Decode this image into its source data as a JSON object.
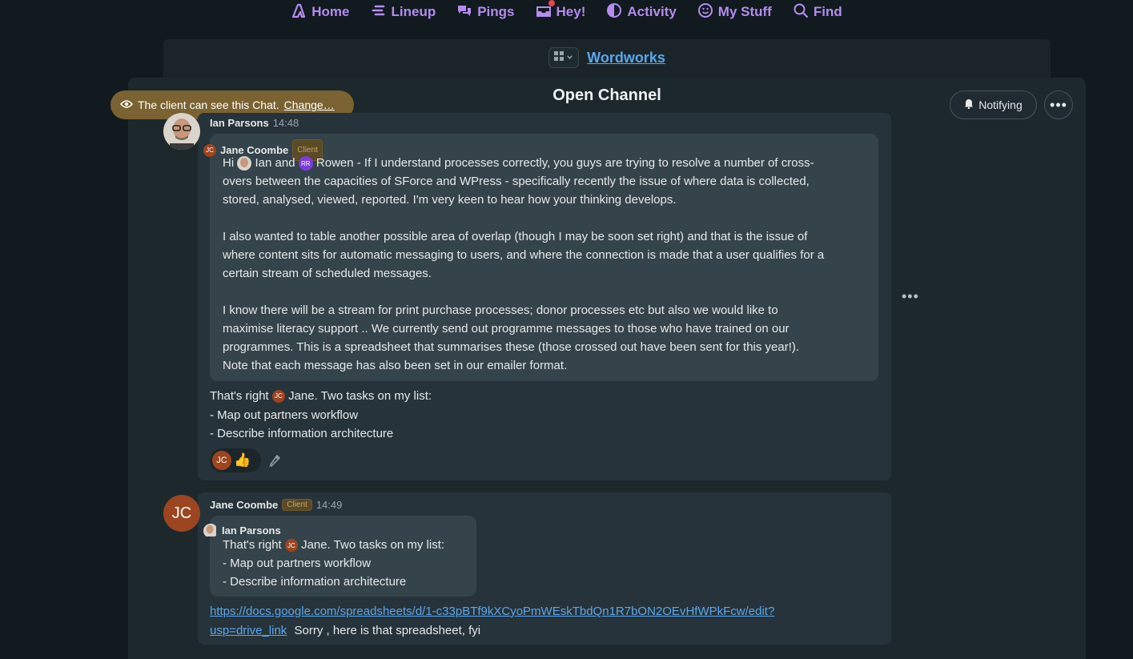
{
  "nav": {
    "home": "Home",
    "lineup": "Lineup",
    "pings": "Pings",
    "hey": "Hey!",
    "activity": "Activity",
    "my_stuff": "My Stuff",
    "find": "Find"
  },
  "project": {
    "name": "Wordworks"
  },
  "channel": {
    "title": "Open Channel",
    "visibility_text": "The client can see this Chat.",
    "visibility_change": "Change…",
    "notify_label": "Notifying",
    "more_label": "•••"
  },
  "messages": [
    {
      "author": "Ian Parsons",
      "time": "14:48",
      "quote": {
        "author": "Jane Coombe",
        "badge": "Client",
        "avatar_initials": "JC",
        "p1_prefix": "Hi",
        "p1_mention_ian": "Ian and",
        "p1_mention_rr_initials": "RR",
        "p1_line1_rest": "Rowen - If I understand processes correctly, you guys are trying to resolve a number of cross-",
        "p1_line2": "overs between the capacities of  SForce  and WPress - specifically recently the issue of where data is collected,",
        "p1_line3": "stored, analysed, viewed, reported.  I'm very keen to hear how your thinking develops.",
        "p2_line1": "I also wanted to table another possible area of overlap (though I may be soon set right) and that is the issue of",
        "p2_line2": "where content sits for automatic messaging to users, and where the connection is made that a user qualifies for a",
        "p2_line3": "certain stream of scheduled messages.",
        "p3_line1": "I know there will be a stream for print purchase processes; donor processes etc but also we would like to",
        "p3_line2": "maximise literacy support .. We currently send out programme messages to those who have trained on our",
        "p3_line3": "programmes.  This is a spreadsheet that summarises these (those crossed out have been sent for this year!).",
        "p3_line4": "Note that each message has also been set in our emailer format."
      },
      "reply_prefix": "That's right",
      "reply_mention_initials": "JC",
      "reply_suffix": "Jane. Two tasks on my list:",
      "reply_line2": "- Map out partners workflow",
      "reply_line3": "- Describe information architecture",
      "reaction_initials": "JC",
      "reaction_emoji": "👍"
    },
    {
      "author": "Jane Coombe",
      "badge": "Client",
      "time": "14:49",
      "avatar_initials": "JC",
      "quote": {
        "author": "Ian Parsons",
        "line1_prefix": "That's right",
        "line1_mention_initials": "JC",
        "line1_suffix": "Jane. Two tasks on my list:",
        "line2": "- Map out partners workflow",
        "line3": "- Describe information architecture"
      },
      "link_line1": "https://docs.google.com/spreadsheets/d/1-c33pBTf9kXCyoPmWEskTbdQn1R7bON2OEvHfWPkFcw/edit?",
      "link_line2": "usp=drive_link",
      "link_suffix": "Sorry , here is that spreadsheet, fyi"
    }
  ],
  "icons": {
    "home": "home-icon",
    "lineup": "lineup-icon",
    "pings": "chat-bubbles-icon",
    "hey": "inbox-icon",
    "activity": "pie-icon",
    "my_stuff": "smiley-icon",
    "find": "search-icon",
    "eye": "eye-icon",
    "bell": "bell-icon"
  },
  "colors": {
    "nav_accent": "#b58bf0",
    "link": "#5aa7ee",
    "client_badge": "#5a4a25",
    "visibility_pill": "#7a6232",
    "avatar_jc": "#9c4520",
    "avatar_rr": "#7c3ae0"
  }
}
